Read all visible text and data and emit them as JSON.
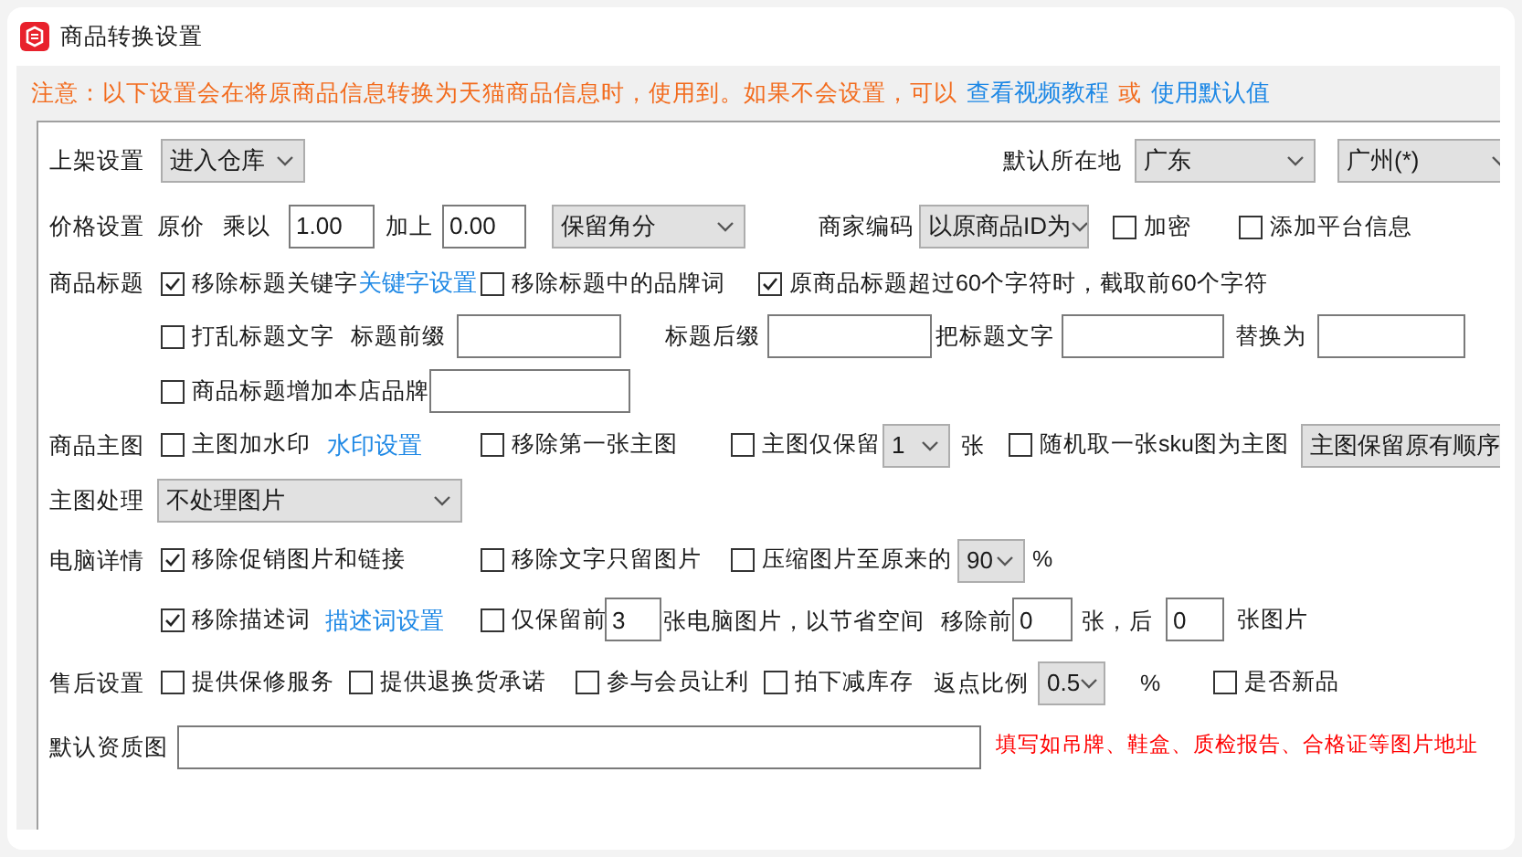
{
  "window": {
    "title": "商品转换设置"
  },
  "notice": {
    "text": "注意：以下设置会在将原商品信息转换为天猫商品信息时，使用到。如果不会设置，可以",
    "link_video": "查看视频教程",
    "or": "或",
    "link_default": "使用默认值"
  },
  "listing": {
    "label": "上架设置",
    "mode": "进入仓库",
    "location_label": "默认所在地",
    "province": "广东",
    "city": "广州(*)"
  },
  "price": {
    "label": "价格设置",
    "original": "原价",
    "multiply_label": "乘以",
    "multiply": "1.00",
    "add_label": "加上",
    "add": "0.00",
    "rounding": "保留角分",
    "merchant_code_label": "商家编码",
    "merchant_code": "以原商品ID为",
    "encrypt": {
      "label": "加密",
      "checked": false
    },
    "platform_info": {
      "label": "添加平台信息",
      "checked": false
    }
  },
  "title": {
    "label": "商品标题",
    "remove_keywords": {
      "label": "移除标题关键字",
      "checked": true
    },
    "keyword_link": "关键字设置",
    "remove_brand": {
      "label": "移除标题中的品牌词",
      "checked": false
    },
    "truncate": {
      "label": "原商品标题超过60个字符时，截取前60个字符",
      "checked": true
    },
    "shuffle": {
      "label": "打乱标题文字",
      "checked": false
    },
    "prefix_label": "标题前缀",
    "suffix_label": "标题后缀",
    "replace_from_label": "把标题文字",
    "replace_to_label": "替换为",
    "add_brand": {
      "label": "商品标题增加本店品牌",
      "checked": false
    }
  },
  "main_image": {
    "label": "商品主图",
    "watermark": {
      "label": "主图加水印",
      "checked": false
    },
    "watermark_link": "水印设置",
    "remove_first": {
      "label": "移除第一张主图",
      "checked": false
    },
    "keep_only": {
      "label": "主图仅保留",
      "checked": false
    },
    "keep_count": "1",
    "keep_unit": "张",
    "random_sku": {
      "label": "随机取一张sku图为主图",
      "checked": false
    },
    "order_button": "主图保留原有顺序"
  },
  "image_processing": {
    "label": "主图处理",
    "value": "不处理图片"
  },
  "pc_detail": {
    "label": "电脑详情",
    "remove_promo": {
      "label": "移除促销图片和链接",
      "checked": true
    },
    "remove_text": {
      "label": "移除文字只留图片",
      "checked": false
    },
    "compress": {
      "label": "压缩图片至原来的",
      "checked": false
    },
    "compress_value": "90",
    "compress_unit": "%",
    "remove_desc": {
      "label": "移除描述词",
      "checked": true
    },
    "desc_link": "描述词设置",
    "keep_first": {
      "label": "仅保留前",
      "checked": false
    },
    "keep_first_value": "3",
    "keep_first_suffix": "张电脑图片，以节省空间",
    "remove_before_label": "移除前",
    "remove_before": "0",
    "remove_after_label": "张，后",
    "remove_after": "0",
    "remove_after_suffix": "张图片"
  },
  "after_sales": {
    "label": "售后设置",
    "warranty": {
      "label": "提供保修服务",
      "checked": false
    },
    "returns": {
      "label": "提供退换货承诺",
      "checked": false
    },
    "member_discount": {
      "label": "参与会员让利",
      "checked": false
    },
    "reduce_stock": {
      "label": "拍下减库存",
      "checked": false
    },
    "rebate_label": "返点比例",
    "rebate": "0.5",
    "rebate_unit": "%",
    "new_item": {
      "label": "是否新品",
      "checked": false
    }
  },
  "qualification": {
    "label": "默认资质图",
    "hint": "填写如吊牌、鞋盒、质检报告、合格证等图片地址"
  }
}
